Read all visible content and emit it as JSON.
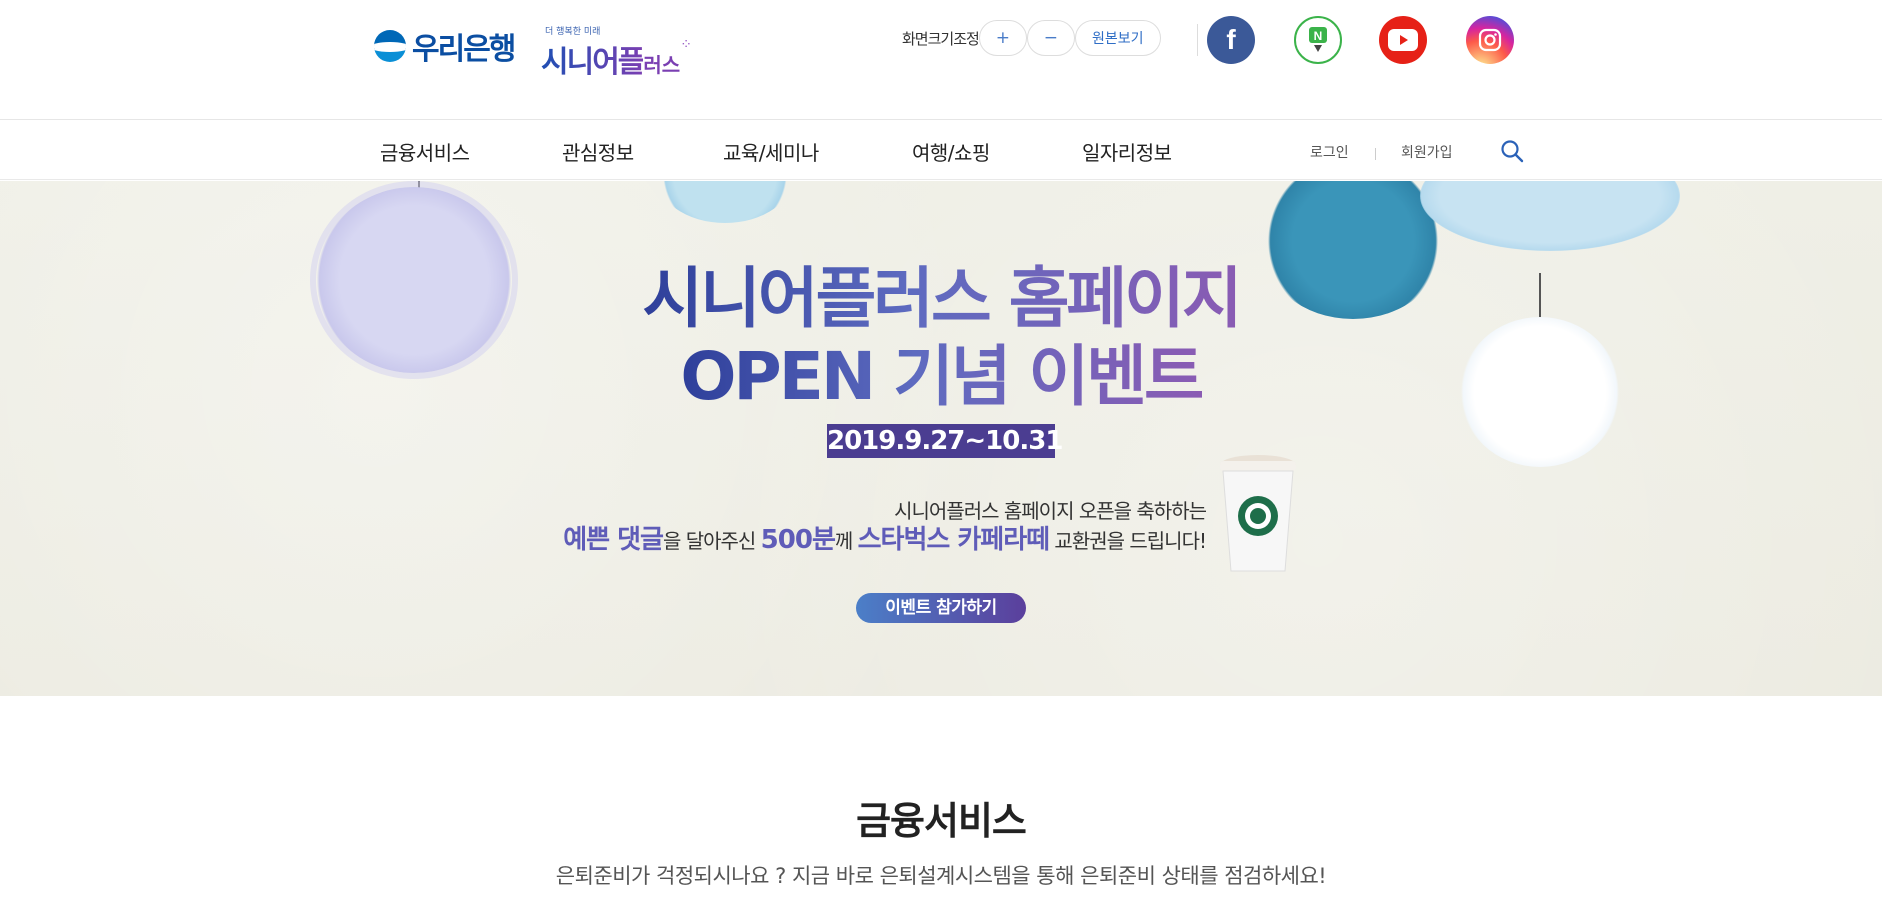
{
  "header": {
    "bank_logo": "우리은행",
    "senior_sub": "더 행복한 미래",
    "senior_main": "시니어플",
    "senior_tail": "러스",
    "font_size_label": "화면크기조정",
    "font_plus": "+",
    "font_minus": "−",
    "font_original": "원본보기",
    "sns": [
      "facebook-icon",
      "naver-blog-icon",
      "youtube-icon",
      "instagram-icon"
    ],
    "brand_color": "#0b4ea2"
  },
  "nav": {
    "items": [
      "금융서비스",
      "관심정보",
      "교육/세미나",
      "여행/쇼핑",
      "일자리정보"
    ],
    "login": "로그인",
    "signup": "회원가입"
  },
  "banner": {
    "title_line1": "시니어플러스 홈페이지",
    "title_line2": "OPEN 기념 이벤트",
    "date": "2019.9.27~10.31",
    "copy_line1": "시니어플러스 홈페이지 오픈을 축하하는",
    "copy_hl1": "예쁜 댓글",
    "copy_mid1": "을 달아주신 ",
    "copy_hl2": "500분",
    "copy_mid2": "께 ",
    "copy_hl3": "스타벅스 카페라떼",
    "copy_end": " 교환권을 드립니다!",
    "button": "이벤트 참가하기",
    "accent_color": "#4b3d91"
  },
  "section": {
    "title": "금융서비스",
    "description": "은퇴준비가 걱정되시나요 ? 지금 바로 은퇴설계시스템을 통해 은퇴준비 상태를 점검하세요!"
  }
}
